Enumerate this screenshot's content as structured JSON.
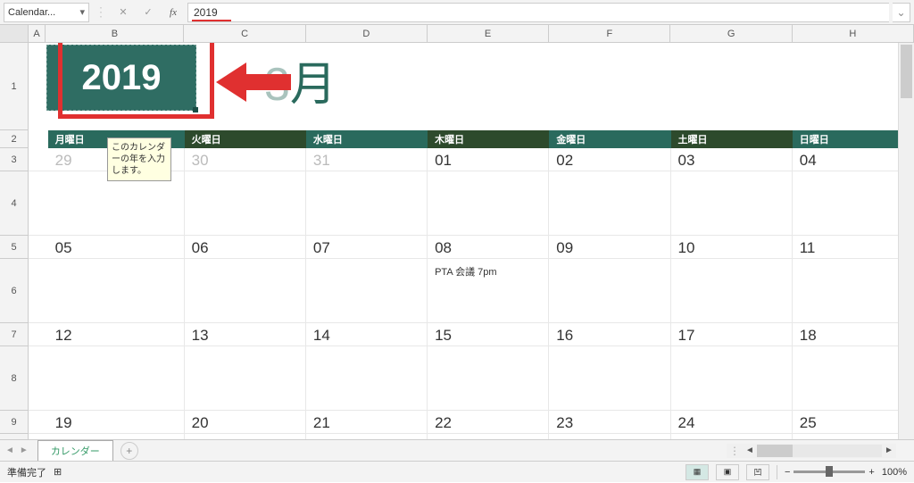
{
  "formulaBar": {
    "nameBox": "Calendar...",
    "formula": "2019"
  },
  "columns": [
    "A",
    "B",
    "C",
    "D",
    "E",
    "F",
    "G",
    "H"
  ],
  "rows": [
    "1",
    "2",
    "3",
    "4",
    "5",
    "6",
    "7",
    "8",
    "9"
  ],
  "title": {
    "year": "2019",
    "monthLabel": "月",
    "monthPrefix": "3"
  },
  "weekdays": [
    "月曜日",
    "火曜日",
    "水曜日",
    "木曜日",
    "金曜日",
    "土曜日",
    "日曜日"
  ],
  "tooltip": "このカレンダーの年を入力します。",
  "weeks": [
    {
      "dates": [
        "29",
        "30",
        "31",
        "01",
        "02",
        "03",
        "04"
      ],
      "gray": [
        0,
        1,
        2
      ],
      "events": {}
    },
    {
      "dates": [
        "05",
        "06",
        "07",
        "08",
        "09",
        "10",
        "11"
      ],
      "gray": [],
      "events": {
        "3": "PTA 会議 7pm"
      }
    },
    {
      "dates": [
        "12",
        "13",
        "14",
        "15",
        "16",
        "17",
        "18"
      ],
      "gray": [],
      "events": {}
    },
    {
      "dates": [
        "19",
        "20",
        "21",
        "22",
        "23",
        "24",
        "25"
      ],
      "gray": [],
      "events": {}
    }
  ],
  "sheetTab": "カレンダー",
  "statusBar": {
    "ready": "準備完了",
    "zoom": "100%"
  }
}
